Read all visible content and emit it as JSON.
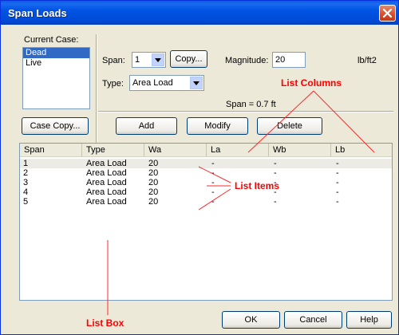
{
  "window": {
    "title": "Span Loads"
  },
  "current_case": {
    "label": "Current Case:",
    "items": [
      "Dead",
      "Live"
    ],
    "selected": "Dead"
  },
  "span": {
    "label": "Span:",
    "value": "1",
    "copy_button": "Copy..."
  },
  "magnitude": {
    "label": "Magnitude:",
    "value": "20",
    "unit": "lb/ft2"
  },
  "type": {
    "label": "Type:",
    "value": "Area Load"
  },
  "span_info": "Span = 0.7 ft",
  "buttons": {
    "case_copy": "Case Copy...",
    "add": "Add",
    "modify": "Modify",
    "delete": "Delete",
    "ok": "OK",
    "cancel": "Cancel",
    "help": "Help"
  },
  "list": {
    "columns": [
      "Span",
      "Type",
      "Wa",
      "La",
      "Wb",
      "Lb"
    ],
    "rows": [
      [
        "1",
        "Area Load",
        "20",
        "-",
        "-",
        "-"
      ],
      [
        "2",
        "Area Load",
        "20",
        "-",
        "-",
        "-"
      ],
      [
        "3",
        "Area Load",
        "20",
        "-",
        "-",
        "-"
      ],
      [
        "4",
        "Area Load",
        "20",
        "-",
        "-",
        "-"
      ],
      [
        "5",
        "Area Load",
        "20",
        "-",
        "-",
        "-"
      ]
    ]
  },
  "annotations": {
    "list_columns": "List Columns",
    "list_items": "List Items",
    "list_box": "List Box",
    "color": "#ff0000"
  },
  "icons": {
    "close": "close-icon",
    "dropdown": "chevron-down-icon"
  }
}
